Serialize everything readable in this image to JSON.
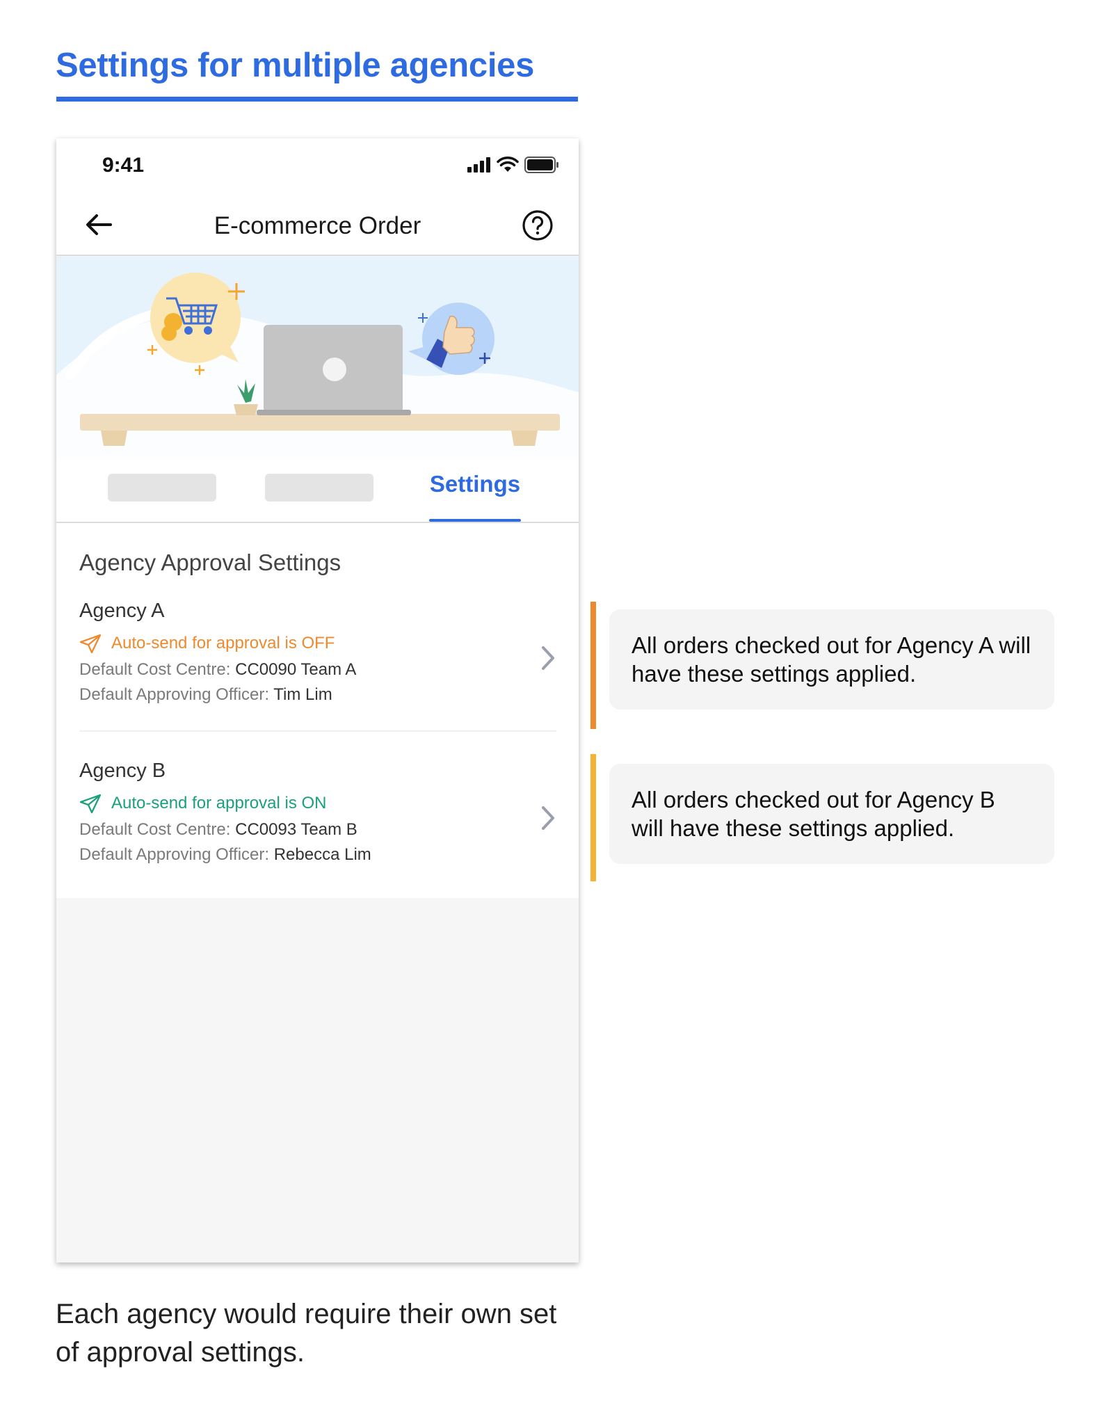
{
  "page": {
    "title": "Settings for multiple agencies",
    "caption": "Each agency would require their own set of approval settings."
  },
  "status_bar": {
    "time": "9:41",
    "icons": [
      "cellular-signal-icon",
      "wifi-icon",
      "battery-icon"
    ]
  },
  "nav": {
    "title": "E-commerce Order",
    "back_icon": "arrow-left-icon",
    "help_icon": "question-circle-icon"
  },
  "tabs": {
    "active_label": "Settings",
    "placeholder_count_visible": 2
  },
  "settings": {
    "section_title": "Agency Approval Settings",
    "agencies": [
      {
        "name": "Agency A",
        "auto_send": "Auto-send for approval is OFF",
        "auto_send_state": "off",
        "cost_centre_label": "Default Cost Centre: ",
        "cost_centre_value": "CC0090 Team A",
        "officer_label": "Default Approving Officer: ",
        "officer_value": "Tim Lim"
      },
      {
        "name": "Agency B",
        "auto_send": "Auto-send for approval is ON",
        "auto_send_state": "on",
        "cost_centre_label": "Default Cost Centre: ",
        "cost_centre_value": "CC0093 Team B",
        "officer_label": "Default Approving Officer: ",
        "officer_value": "Rebecca Lim"
      }
    ]
  },
  "annotations": [
    {
      "text": "All orders checked out for Agency A will have these settings applied.",
      "color": "#ee8a2e"
    },
    {
      "text": "All orders checked out for Agency B will have these settings applied.",
      "color": "#f5b335"
    }
  ],
  "colors": {
    "accent_blue": "#2f6be0",
    "off_orange": "#ee8a2e",
    "on_green": "#1aa07d"
  }
}
